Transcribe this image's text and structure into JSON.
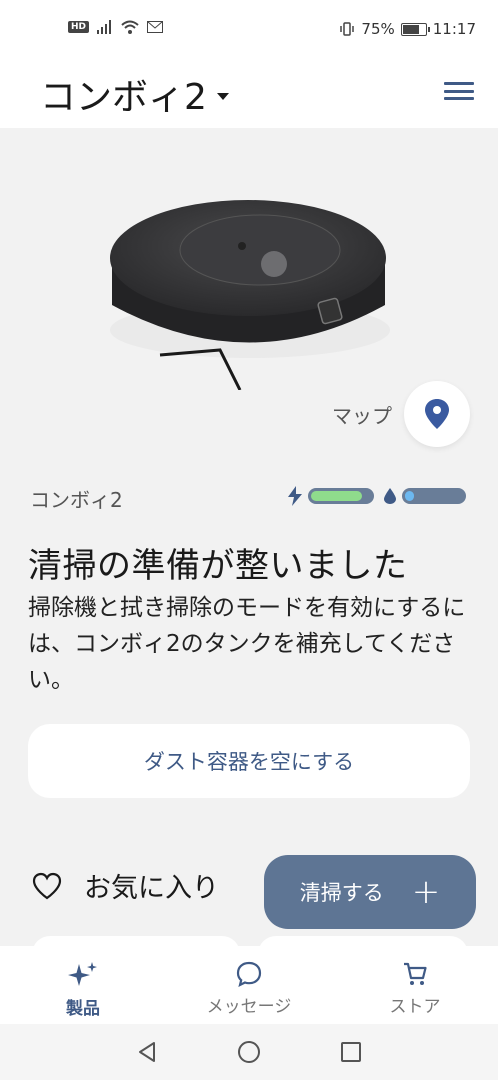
{
  "status_bar": {
    "badge": "HD",
    "battery_percent": "75%",
    "battery_level": 0.75,
    "time": "11:17"
  },
  "header": {
    "title": "コンボィ2"
  },
  "map": {
    "label": "マップ"
  },
  "robot": {
    "name": "コンボィ2",
    "battery_level": 0.85,
    "water_level": 0.05,
    "battery_color": "#8fdc8c",
    "water_color": "#6cb8f0"
  },
  "status": {
    "heading": "清掃の準備が整いました",
    "description": "掃除機と拭き掃除のモードを有効にするには、コンボィ2のタンクを補充してください。"
  },
  "actions": {
    "empty_bin": "ダスト容器を空にする",
    "favorites": "お気に入り",
    "clean": "清掃する"
  },
  "nav": {
    "products": "製品",
    "messages": "メッセージ",
    "store": "ストア"
  },
  "colors": {
    "accent": "#3f5a86",
    "clean_button": "#5e7594"
  }
}
